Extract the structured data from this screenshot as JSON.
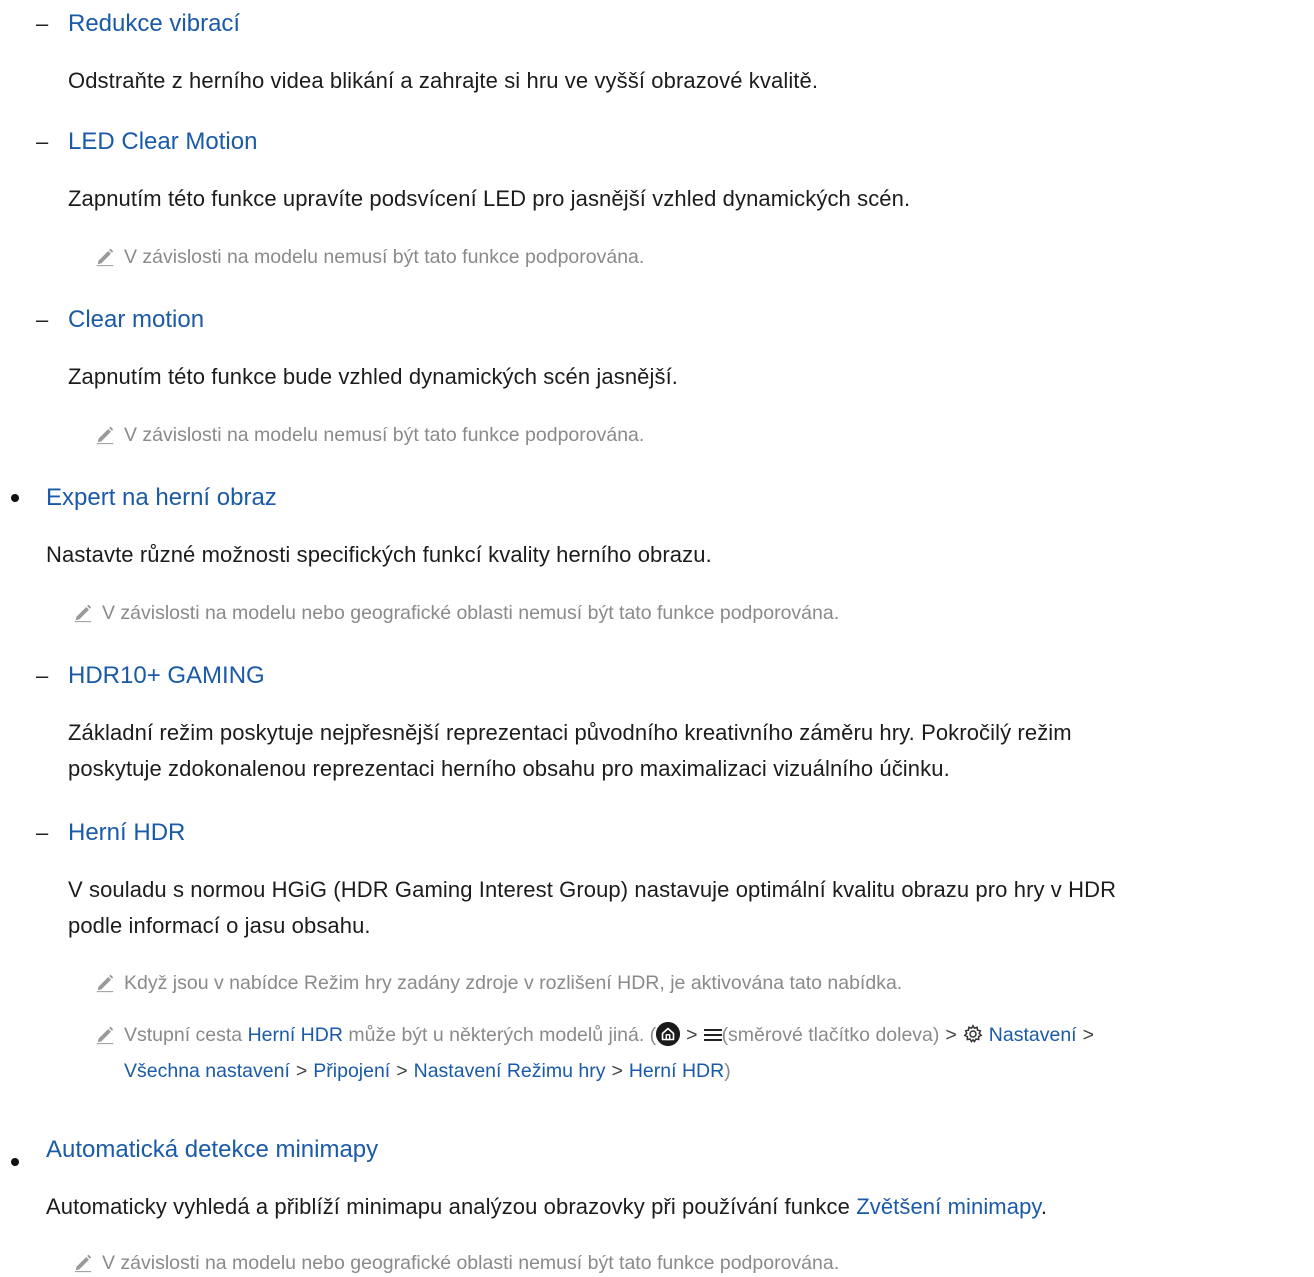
{
  "items": {
    "redukce": {
      "title": "Redukce vibrací",
      "desc": "Odstraňte z herního videa blikání a zahrajte si hru ve vyšší obrazové kvalitě."
    },
    "led": {
      "title": "LED Clear Motion",
      "desc": "Zapnutím této funkce upravíte podsvícení LED pro jasnější vzhled dynamických scén.",
      "note": "V závislosti na modelu nemusí být tato funkce podporována."
    },
    "clear": {
      "title": "Clear motion",
      "desc": "Zapnutím této funkce bude vzhled dynamických scén jasnější.",
      "note": "V závislosti na modelu nemusí být tato funkce podporována."
    },
    "expert": {
      "title": "Expert na herní obraz",
      "desc": "Nastavte různé možnosti specifických funkcí kvality herního obrazu.",
      "note": "V závislosti na modelu nebo geografické oblasti nemusí být tato funkce podporována."
    },
    "hdr10": {
      "title": "HDR10+ GAMING",
      "desc_line1": "Základní režim poskytuje nejpřesnější reprezentaci původního kreativního záměru hry. Pokročilý režim",
      "desc_line2": "poskytuje zdokonalenou reprezentaci herního obsahu pro maximalizaci vizuálního účinku."
    },
    "hernihdr": {
      "title": "Herní HDR",
      "desc_line1": "V souladu s normou HGiG (HDR Gaming Interest Group) nastavuje optimální kvalitu obrazu pro hry v HDR",
      "desc_line2": "podle informací o jasu obsahu.",
      "note1": "Když jsou v nabídce Režim hry zadány zdroje v rozlišení HDR, je aktivována tato nabídka.",
      "note2": {
        "prefix": "Vstupní cesta ",
        "link1": "Herní HDR",
        "middle": " může být u některých modelů jiná. (",
        "menu_text": "(směrové tlačítko doleva)",
        "settings": "Nastavení",
        "all_settings": "Všechna nastavení",
        "connection": "Připojení",
        "game_mode_settings": "Nastavení Režimu hry",
        "link_end": "Herní HDR",
        "close": ")",
        "chevron": ">"
      }
    },
    "minimap": {
      "title": "Automatická detekce minimapy",
      "desc_prefix": "Automaticky vyhledá a přiblíží minimapu analýzou obrazovky při používání funkce ",
      "desc_link": "Zvětšení minimapy",
      "desc_suffix": ".",
      "note": "V závislosti na modelu nebo geografické oblasti nemusí být tato funkce podporována."
    }
  },
  "glyphs": {
    "dash": "–"
  },
  "colors": {
    "link": "#1a5aa8",
    "note": "#8a8a8a",
    "text": "#1c1c1c"
  },
  "icons": [
    "pencil-note-icon",
    "home-icon",
    "menu-icon",
    "gear-icon",
    "chevron-right-icon"
  ]
}
